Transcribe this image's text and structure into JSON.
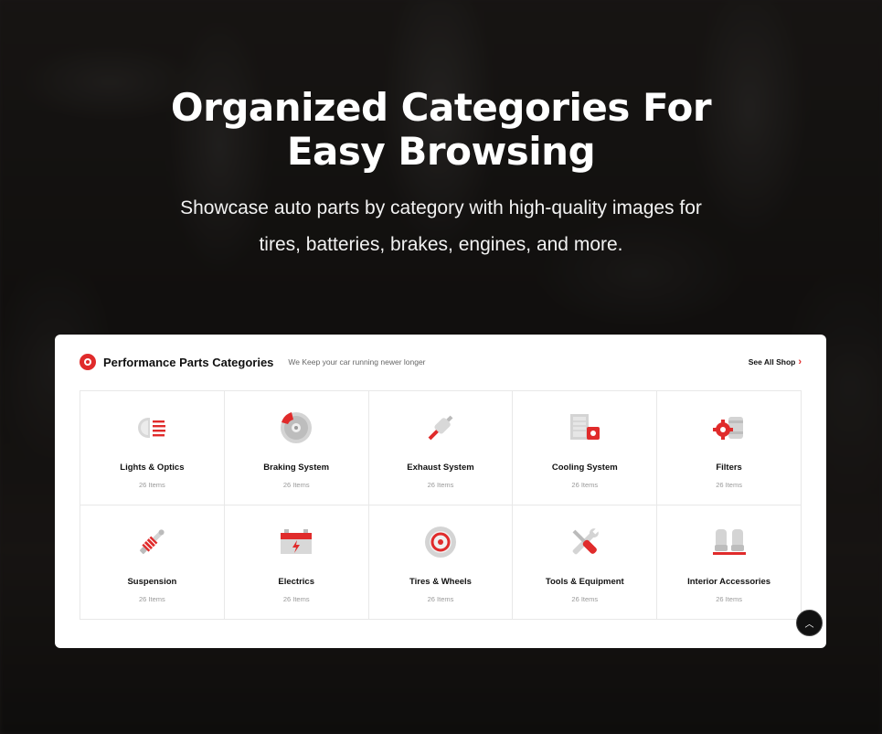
{
  "hero": {
    "title": "Organized Categories For Easy Browsing",
    "subtitle": "Showcase auto parts by category with high-quality images for tires, batteries, brakes, engines, and more."
  },
  "card": {
    "title": "Performance Parts Categories",
    "subtitle": "We Keep your car running newer longer",
    "see_all": "See All Shop"
  },
  "categories": [
    {
      "name": "Lights & Optics",
      "count": "26 Items",
      "icon": "headlight-icon"
    },
    {
      "name": "Braking System",
      "count": "26 Items",
      "icon": "brake-disc-icon"
    },
    {
      "name": "Exhaust System",
      "count": "26 Items",
      "icon": "exhaust-icon"
    },
    {
      "name": "Cooling System",
      "count": "26 Items",
      "icon": "radiator-icon"
    },
    {
      "name": "Filters",
      "count": "26 Items",
      "icon": "filter-icon"
    },
    {
      "name": "Suspension",
      "count": "26 Items",
      "icon": "shock-absorber-icon"
    },
    {
      "name": "Electrics",
      "count": "26 Items",
      "icon": "battery-icon"
    },
    {
      "name": "Tires & Wheels",
      "count": "26 Items",
      "icon": "wheel-icon"
    },
    {
      "name": "Tools & Equipment",
      "count": "26 Items",
      "icon": "wrench-screwdriver-icon"
    },
    {
      "name": "Interior Accessories",
      "count": "26 Items",
      "icon": "car-seats-icon"
    }
  ],
  "colors": {
    "accent": "#e02b2b",
    "text": "#111111",
    "muted": "#999999"
  }
}
